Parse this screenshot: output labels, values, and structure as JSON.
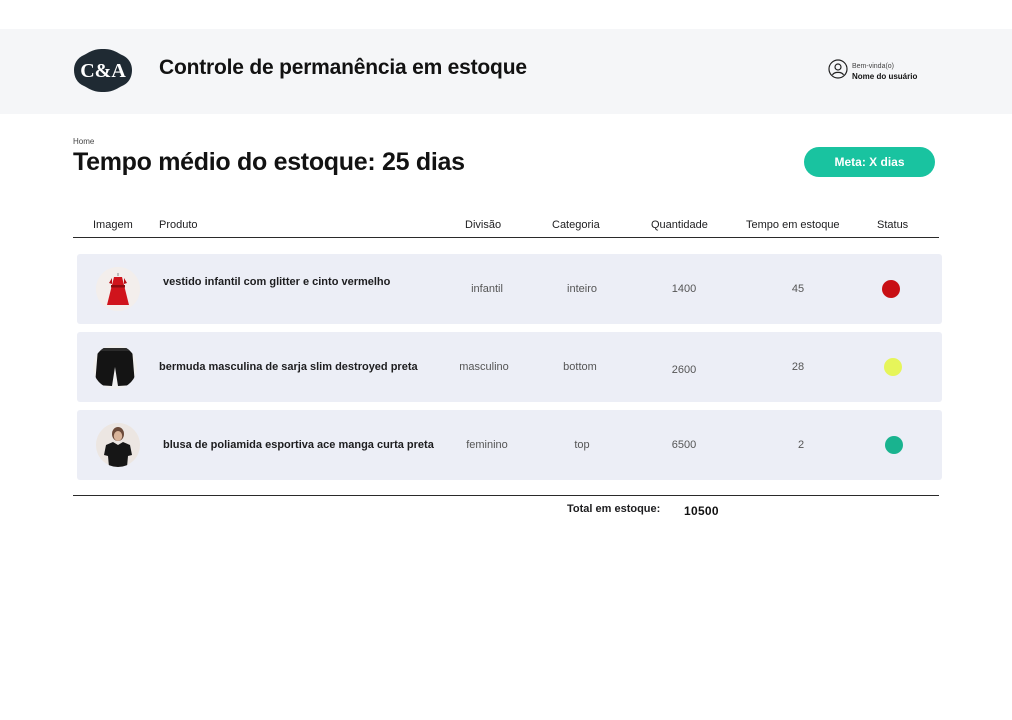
{
  "header": {
    "logo_text": "C&A",
    "title": "Controle de permanência em estoque",
    "user": {
      "welcome": "Bem-vinda(o)",
      "name": "Nome do usuário",
      "icon": "user-circle-icon"
    }
  },
  "breadcrumb": "Home",
  "page_title": "Tempo médio do estoque: 25 dias",
  "goal_button": "Meta: X dias",
  "table": {
    "columns": [
      "Imagem",
      "Produto",
      "Divisão",
      "Categoria",
      "Quantidade",
      "Tempo em estoque",
      "Status"
    ],
    "rows": [
      {
        "image": "red-dress-image",
        "product": "vestido infantil com glitter e cinto vermelho",
        "division": "infantil",
        "category": "inteiro",
        "quantity": "1400",
        "time": "45",
        "status_color": "#c80f14"
      },
      {
        "image": "black-shorts-image",
        "product": "bermuda masculina de sarja slim destroyed preta",
        "division": "masculino",
        "category": "bottom",
        "quantity": "2600",
        "time": "28",
        "status_color": "#e6f55a"
      },
      {
        "image": "black-blouse-image",
        "product": "blusa de poliamida esportiva ace manga curta preta",
        "division": "feminino",
        "category": "top",
        "quantity": "6500",
        "time": "2",
        "status_color": "#19b38f"
      }
    ]
  },
  "total": {
    "label": "Total em estoque:",
    "value": "10500"
  },
  "colors": {
    "accent": "#19c3a0",
    "header_bg": "#f5f6f8",
    "row_bg": "#eceef6",
    "logo_bg": "#1f2a33"
  }
}
